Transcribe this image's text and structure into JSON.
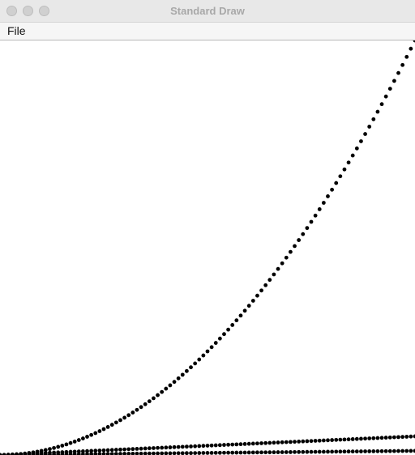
{
  "window": {
    "title": "Standard Draw",
    "buttons": [
      "close-button",
      "minimize-button",
      "zoom-button"
    ]
  },
  "menubar": {
    "items": [
      {
        "label": "File"
      }
    ]
  },
  "canvas": {
    "background": "#ffffff",
    "dot_color": "#000000"
  },
  "chart_data": {
    "type": "scatter",
    "title": "",
    "xlabel": "",
    "ylabel": "",
    "xlim": [
      0,
      1
    ],
    "ylim": [
      0,
      1
    ],
    "grid": false,
    "legend": "none",
    "series": [
      {
        "x_from": 0,
        "x_to": 1,
        "points": 100,
        "formula": "x^2"
      },
      {
        "x_from": 0,
        "x_to": 1,
        "points": 100,
        "formula": "0.045*x"
      },
      {
        "x_from": 0,
        "x_to": 1,
        "points": 100,
        "formula": "0.01*x"
      }
    ]
  }
}
